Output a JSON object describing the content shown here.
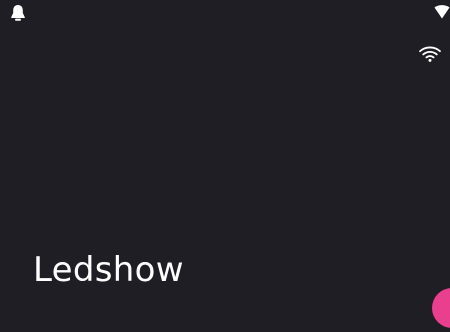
{
  "app": {
    "title": "Ledshow"
  },
  "status_bar": {
    "left_icon": "notification-icon",
    "right_icon": "signal-icon"
  },
  "header": {
    "connection_icon": "wifi-icon"
  },
  "fab": {
    "icon": "add-icon"
  },
  "colors": {
    "background": "#1f1e24",
    "text": "#ffffff",
    "accent": "#e8408f"
  }
}
